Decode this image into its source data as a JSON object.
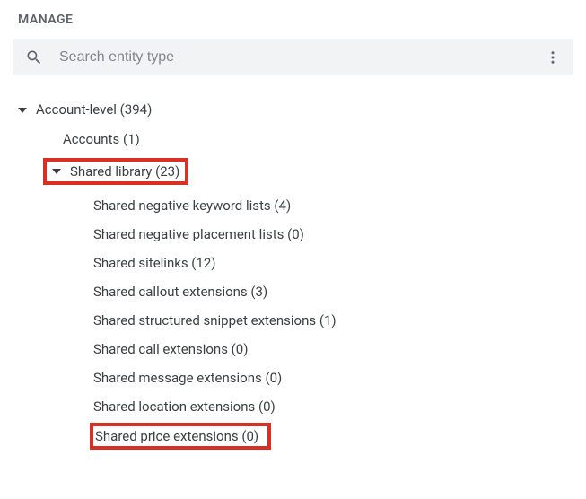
{
  "header": {
    "title": "MANAGE"
  },
  "search": {
    "placeholder": "Search entity type",
    "value": ""
  },
  "tree": {
    "root": {
      "label": "Account-level (394)"
    },
    "accounts": {
      "label": "Accounts (1)"
    },
    "sharedLibrary": {
      "label": "Shared library (23)"
    },
    "children": [
      {
        "label": "Shared negative keyword lists (4)"
      },
      {
        "label": "Shared negative placement lists (0)"
      },
      {
        "label": "Shared sitelinks (12)"
      },
      {
        "label": "Shared callout extensions (3)"
      },
      {
        "label": "Shared structured snippet extensions (1)"
      },
      {
        "label": "Shared call extensions (0)"
      },
      {
        "label": "Shared message extensions (0)"
      },
      {
        "label": "Shared location extensions (0)"
      },
      {
        "label": "Shared price extensions (0)"
      }
    ]
  }
}
